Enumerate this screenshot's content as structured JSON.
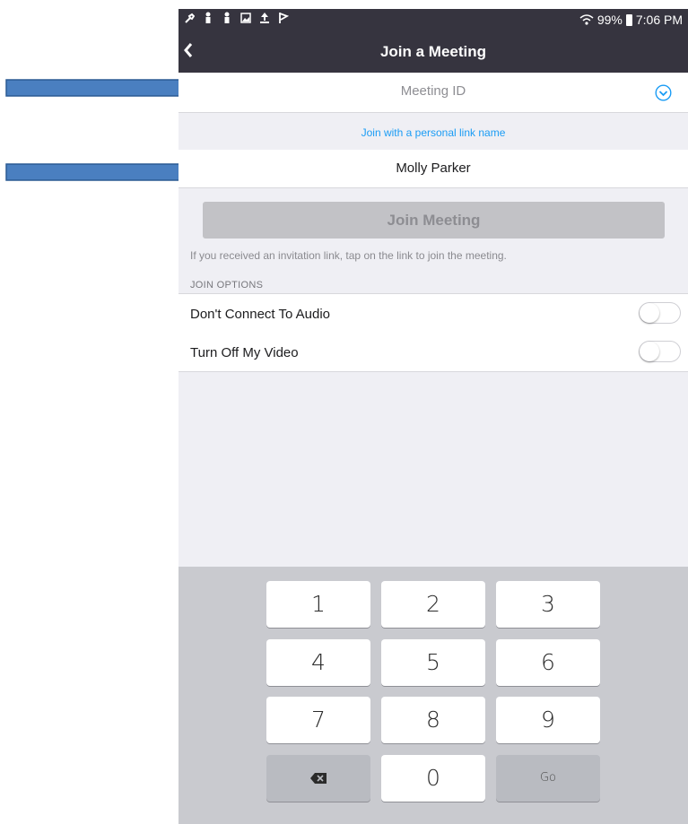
{
  "status_bar": {
    "battery_percent": "99%",
    "time": "7:06 PM",
    "left_icons": [
      "wrench-icon",
      "figure-icon",
      "figure-icon",
      "image-icon",
      "upload-icon",
      "flag-icon"
    ]
  },
  "nav": {
    "title": "Join a Meeting",
    "back_icon": "chevron-left-icon"
  },
  "meeting_id": {
    "placeholder": "Meeting ID",
    "dropdown_icon": "chevron-down-circle-icon"
  },
  "personal_link": {
    "label": "Join with a personal link name"
  },
  "name_field": {
    "value": "Molly Parker"
  },
  "join_button": {
    "label": "Join Meeting",
    "enabled": false
  },
  "hint_text": "If you received an invitation link, tap on the link to join the meeting.",
  "join_options": {
    "header": "JOIN OPTIONS",
    "items": [
      {
        "label": "Don't Connect To Audio",
        "on": false
      },
      {
        "label": "Turn Off My Video",
        "on": false
      }
    ]
  },
  "keyboard": {
    "keys": [
      "1",
      "2",
      "3",
      "4",
      "5",
      "6",
      "7",
      "8",
      "9",
      "",
      "0",
      "Go"
    ],
    "backspace_icon": "backspace-icon"
  },
  "colors": {
    "header_bg": "#36343f",
    "link_blue": "#1a9cf5",
    "arrow_fill": "#4a7fc0",
    "arrow_stroke": "#2b5a93"
  }
}
